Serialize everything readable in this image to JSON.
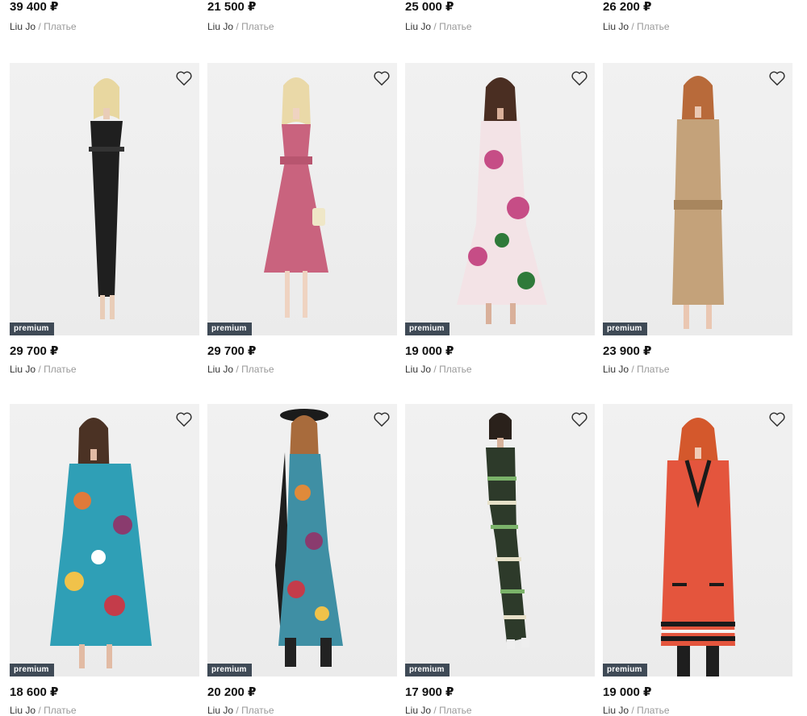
{
  "products_top": [
    {
      "price": "39 400 ₽",
      "brand": "Liu Jo",
      "category": "Платье"
    },
    {
      "price": "21 500 ₽",
      "brand": "Liu Jo",
      "category": "Платье"
    },
    {
      "price": "25 000 ₽",
      "brand": "Liu Jo",
      "category": "Платье"
    },
    {
      "price": "26 200 ₽",
      "brand": "Liu Jo",
      "category": "Платье"
    }
  ],
  "products_row1": [
    {
      "price": "29 700 ₽",
      "brand": "Liu Jo",
      "category": "Платье",
      "badge": "premium",
      "dress_color": "#1f1f1f"
    },
    {
      "price": "29 700 ₽",
      "brand": "Liu Jo",
      "category": "Платье",
      "badge": "premium",
      "dress_color": "#c9637e"
    },
    {
      "price": "19 000 ₽",
      "brand": "Liu Jo",
      "category": "Платье",
      "badge": "premium",
      "dress_color": "#f3e3e6"
    },
    {
      "price": "23 900 ₽",
      "brand": "Liu Jo",
      "category": "Платье",
      "badge": "premium",
      "dress_color": "#c4a27a"
    }
  ],
  "products_row2": [
    {
      "price": "18 600 ₽",
      "brand": "Liu Jo",
      "category": "Платье",
      "badge": "premium",
      "dress_color": "#2f9fb6"
    },
    {
      "price": "20 200 ₽",
      "brand": "Liu Jo",
      "category": "Платье",
      "badge": "premium",
      "dress_color": "#3f8fa4"
    },
    {
      "price": "17 900 ₽",
      "brand": "Liu Jo",
      "category": "Платье",
      "badge": "premium",
      "dress_color": "#2d3a2a"
    },
    {
      "price": "19 000 ₽",
      "brand": "Liu Jo",
      "category": "Платье",
      "badge": "premium",
      "dress_color": "#e4553d"
    }
  ],
  "separator": "/",
  "icons": {
    "favorite": "heart-outline-icon"
  }
}
